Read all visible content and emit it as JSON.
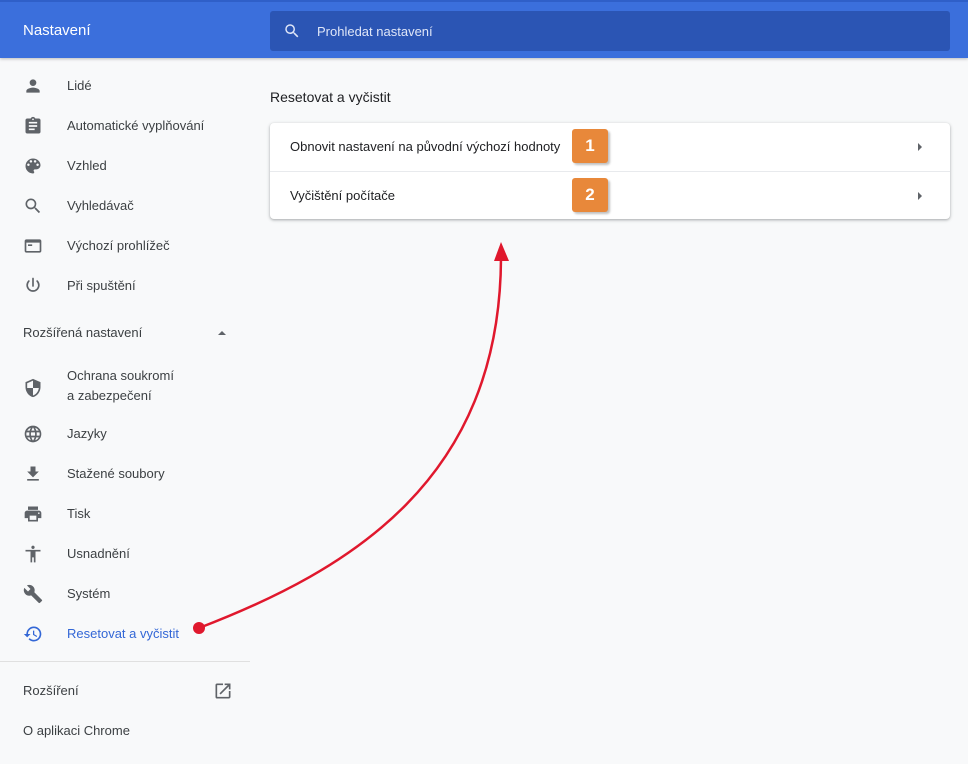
{
  "header": {
    "title": "Nastavení",
    "search_placeholder": "Prohledat nastavení"
  },
  "sidebar": {
    "items": [
      {
        "label": "Lidé",
        "icon": "person-icon"
      },
      {
        "label": "Automatické vyplňování",
        "icon": "clipboard-icon"
      },
      {
        "label": "Vzhled",
        "icon": "palette-icon"
      },
      {
        "label": "Vyhledávač",
        "icon": "search-icon"
      },
      {
        "label": "Výchozí prohlížeč",
        "icon": "browser-window-icon"
      },
      {
        "label": "Při spuštění",
        "icon": "power-icon"
      }
    ],
    "advanced_label": "Rozšířená nastavení",
    "advanced_items": [
      {
        "label_line1": "Ochrana soukromí",
        "label_line2": "a zabezpečení",
        "icon": "shield-icon"
      },
      {
        "label": "Jazyky",
        "icon": "globe-icon"
      },
      {
        "label": "Stažené soubory",
        "icon": "download-icon"
      },
      {
        "label": "Tisk",
        "icon": "printer-icon"
      },
      {
        "label": "Usnadnění",
        "icon": "accessibility-icon"
      },
      {
        "label": "Systém",
        "icon": "wrench-icon"
      },
      {
        "label": "Resetovat a vyčistit",
        "icon": "restore-icon",
        "active": true
      }
    ],
    "extensions_label": "Rozšíření",
    "about_label": "O aplikaci Chrome"
  },
  "main": {
    "section_title": "Resetovat a vyčistit",
    "rows": [
      {
        "label": "Obnovit nastavení na původní výchozí hodnoty",
        "badge": "1"
      },
      {
        "label": "Vyčištění počítače",
        "badge": "2"
      }
    ]
  },
  "colors": {
    "header_bg": "#3b6fdc",
    "search_bg": "#2b55b4",
    "active": "#3367d6",
    "badge": "#e8883a",
    "annotation_arrow": "#e0182d"
  }
}
